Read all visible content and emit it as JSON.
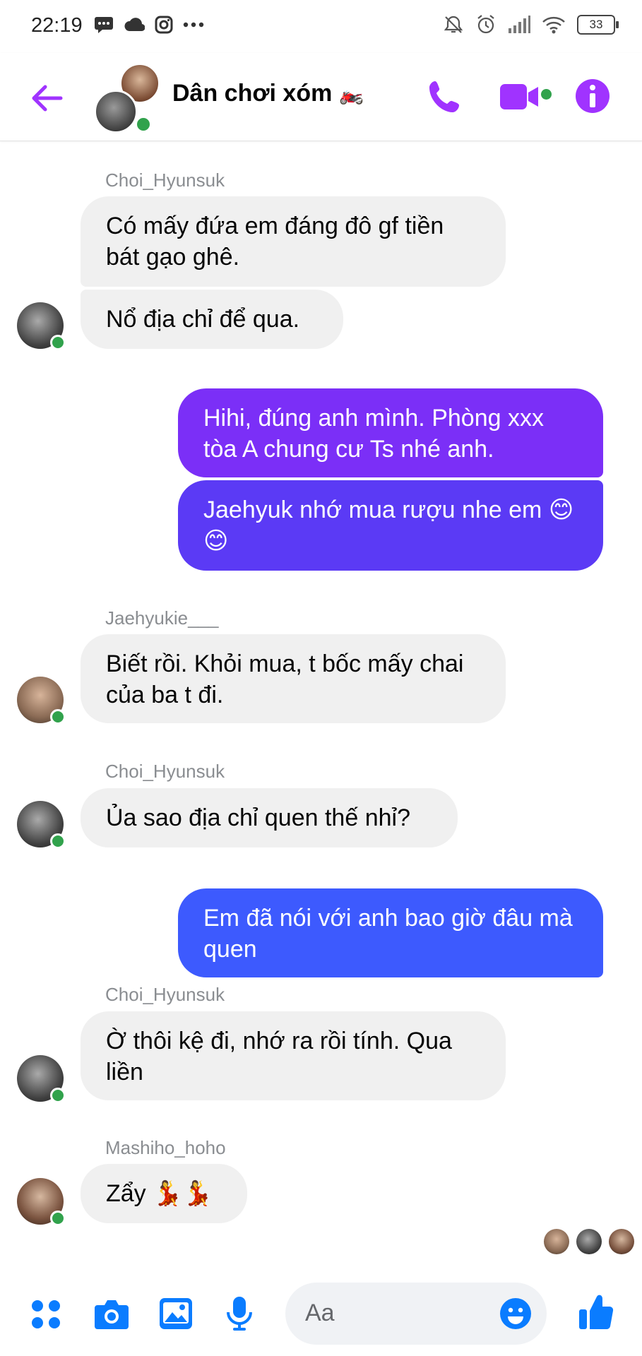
{
  "status_bar": {
    "time": "22:19",
    "battery": "33",
    "left_icons": [
      "message-icon",
      "cloud-icon",
      "instagram-icon",
      "more-icon"
    ],
    "right_icons": [
      "mute-icon",
      "alarm-icon",
      "signal-icon",
      "wifi-icon",
      "battery-icon"
    ]
  },
  "header": {
    "title": "Dân chơi xóm",
    "title_emoji": "🏍️",
    "colors": {
      "accent": "#a033ff",
      "online": "#31a24c"
    }
  },
  "messages": [
    {
      "sender": "Choi_Hyunsuk",
      "direction": "in",
      "bubbles": [
        "Có mấy đứa em đáng đô gf tiền bát gạo ghê.",
        "Nổ địa chỉ để qua."
      ]
    },
    {
      "sender": "",
      "direction": "out",
      "bubbles": [
        "Hihi, đúng anh mình. Phòng xxx tòa A chung cư Ts nhé anh.",
        "Jaehyuk nhớ mua rượu nhe em 😊😊"
      ]
    },
    {
      "sender": "Jaehyukie___",
      "direction": "in",
      "bubbles": [
        "Biết rồi. Khỏi mua, t bốc mấy chai của ba t đi."
      ]
    },
    {
      "sender": "Choi_Hyunsuk",
      "direction": "in",
      "bubbles": [
        "Ủa sao địa chỉ quen thế nhỉ?"
      ]
    },
    {
      "sender": "",
      "direction": "out",
      "bubbles": [
        "Em đã nói với anh bao giờ đâu mà quen"
      ]
    },
    {
      "sender": "Choi_Hyunsuk",
      "direction": "in",
      "bubbles": [
        "Ờ thôi kệ đi, nhớ ra rồi tính. Qua liền"
      ]
    },
    {
      "sender": "Mashiho_hoho",
      "direction": "in",
      "bubbles": [
        "Zẩy 💃💃"
      ]
    }
  ],
  "bubble_colors": {
    "incoming": "#f0f0f0",
    "out_1": "#7b2ff7",
    "out_2": "#5b3af5",
    "out_3": "#3d5afe"
  },
  "composer": {
    "placeholder": "Aa"
  }
}
